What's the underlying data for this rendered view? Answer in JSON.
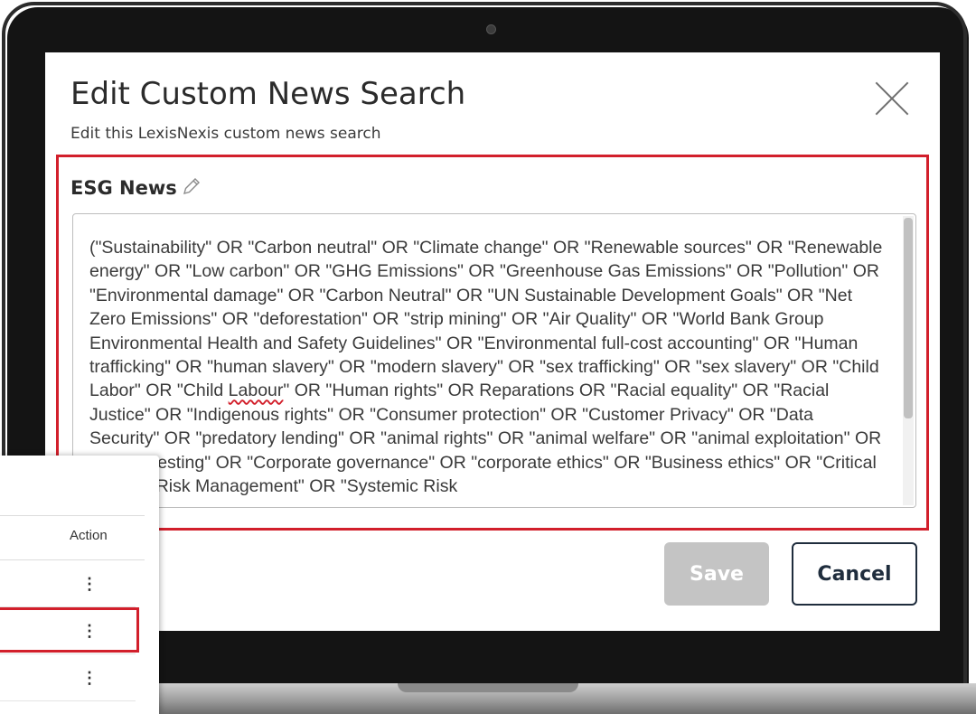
{
  "dialog": {
    "title": "Edit Custom News Search",
    "subtitle": "Edit this LexisNexis custom news search",
    "search_name": "ESG News",
    "query_before_typo": "(\"Sustainability\" OR \"Carbon neutral\" OR \"Climate change\" OR \"Renewable sources\" OR \"Renewable energy\" OR \"Low carbon\" OR \"GHG Emissions\" OR \"Greenhouse Gas Emissions\" OR \"Pollution\" OR \"Environmental damage\" OR \"Carbon Neutral\" OR \"UN Sustainable Development Goals\" OR \"Net Zero Emissions\" OR \"deforestation\" OR \"strip mining\" OR \"Air Quality\" OR \"World Bank Group Environmental Health and Safety Guidelines\" OR \"Environmental full-cost accounting\" OR \"Human trafficking\" OR \"human slavery\" OR \"modern slavery\" OR \"sex trafficking\" OR \"sex slavery\" OR \"Child Labor\" OR \"Child ",
    "query_typo_word": "Labour",
    "query_after_typo": "\" OR \"Human rights\" OR Reparations OR \"Racial equality\" OR \"Racial Justice\" OR \"Indigenous rights\" OR \"Consumer protection\" OR \"Customer Privacy\" OR \"Data Security\" OR \"predatory lending\" OR \"animal rights\" OR \"animal welfare\" OR \"animal exploitation\" OR \"animal testing\" OR \"Corporate governance\" OR \"corporate ethics\" OR \"Business ethics\" OR \"Critical Incident Risk Management\" OR \"Systemic Risk",
    "save_label": "Save",
    "cancel_label": "Cancel"
  },
  "list_panel": {
    "action_header": "Action",
    "rows": [
      {
        "action_icon": "⋮"
      },
      {
        "action_icon": "⋮"
      },
      {
        "action_icon": "⋮"
      }
    ]
  },
  "colors": {
    "highlight": "#d21f2b",
    "save_disabled": "#c4c4c4",
    "cancel_border": "#1f2d3d"
  }
}
